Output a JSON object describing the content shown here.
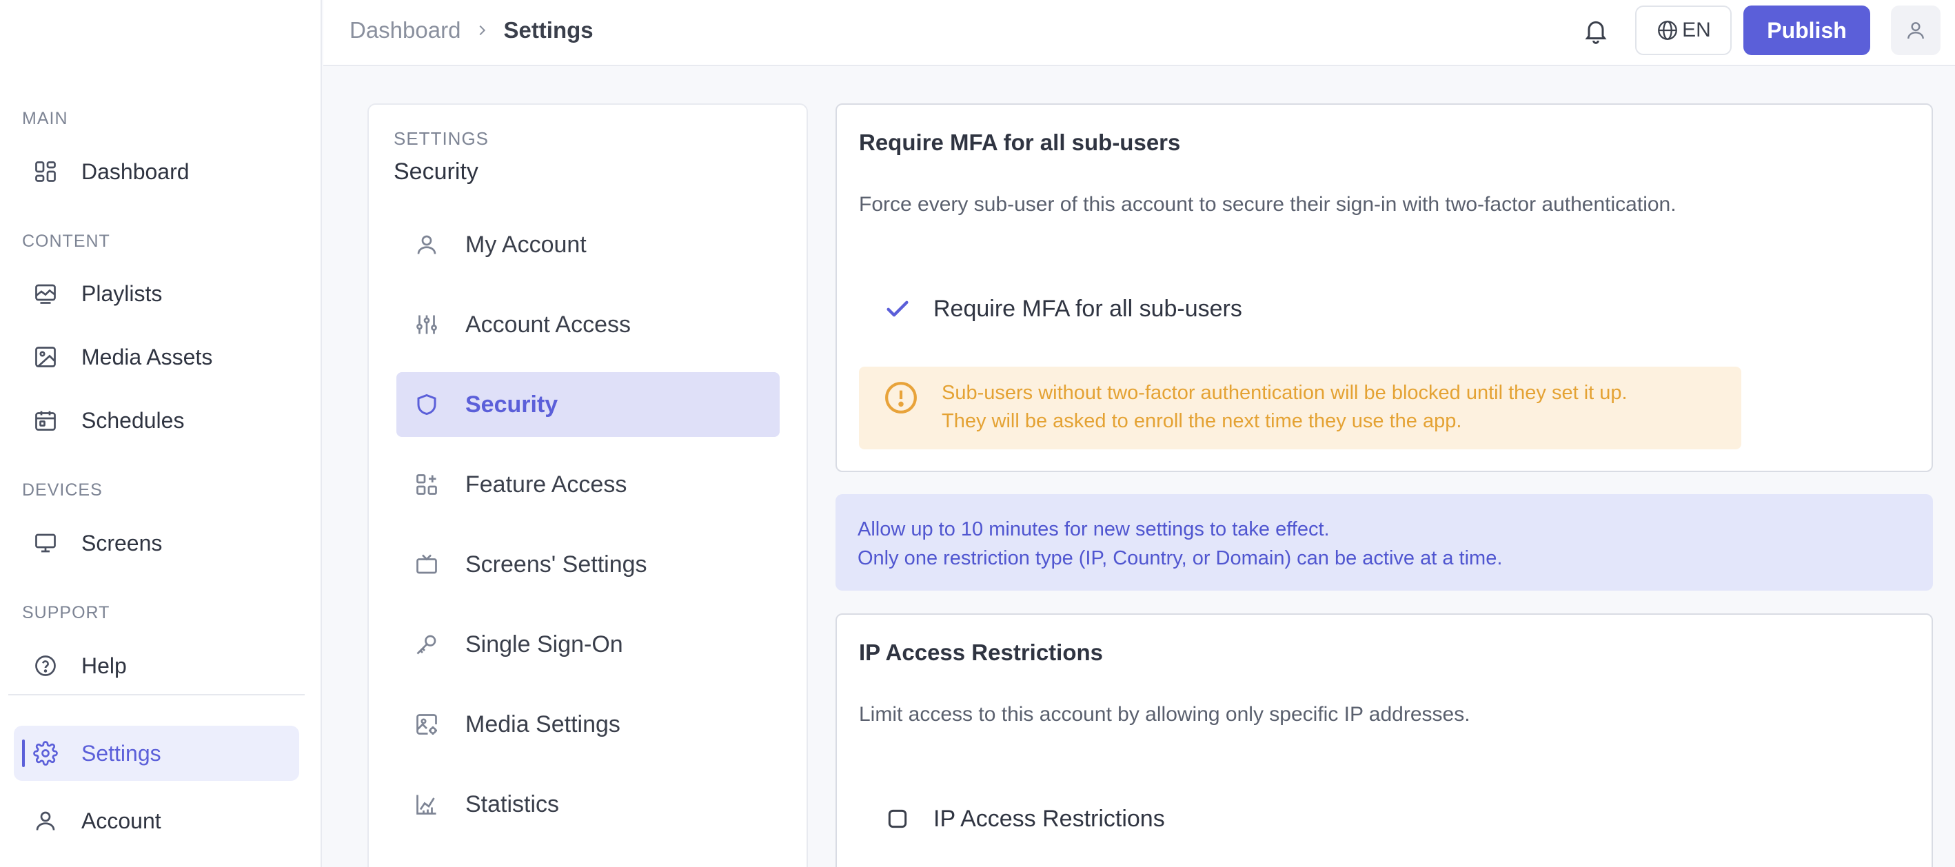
{
  "sidebar": {
    "groups": {
      "main": "MAIN",
      "content": "CONTENT",
      "devices": "DEVICES",
      "support": "SUPPORT"
    },
    "items": {
      "dashboard": "Dashboard",
      "playlists": "Playlists",
      "media_assets": "Media Assets",
      "schedules": "Schedules",
      "screens": "Screens",
      "help": "Help",
      "settings": "Settings",
      "account": "Account"
    },
    "active_item": "settings"
  },
  "topbar": {
    "breadcrumb": {
      "parent": "Dashboard",
      "current": "Settings"
    },
    "language": "EN",
    "publish_label": "Publish"
  },
  "settings_nav": {
    "kicker": "SETTINGS",
    "title": "Security",
    "items": [
      {
        "label": "My Account",
        "icon": "user-icon"
      },
      {
        "label": "Account Access",
        "icon": "sliders-icon"
      },
      {
        "label": "Security",
        "icon": "shield-icon"
      },
      {
        "label": "Feature Access",
        "icon": "grid-plus-icon"
      },
      {
        "label": "Screens' Settings",
        "icon": "tv-icon"
      },
      {
        "label": "Single Sign-On",
        "icon": "key-icon"
      },
      {
        "label": "Media Settings",
        "icon": "image-settings-icon"
      },
      {
        "label": "Statistics",
        "icon": "chart-icon"
      }
    ],
    "active_index": 2
  },
  "mfa_card": {
    "title": "Require MFA for all sub-users",
    "description": "Force every sub-user of this account to secure their sign-in with two-factor authentication.",
    "checkbox_label": "Require MFA for all sub-users",
    "checked": true,
    "warning_line1": "Sub-users without two-factor authentication will be blocked until they set it up.",
    "warning_line2": "They will be asked to enroll the next time they use the app."
  },
  "info_notice": {
    "line1": "Allow up to 10 minutes for new settings to take effect.",
    "line2": "Only one restriction type (IP, Country, or Domain) can be active at a time."
  },
  "ip_card": {
    "title": "IP Access Restrictions",
    "description": "Limit access to this account by allowing only specific IP addresses.",
    "checkbox_label": "IP Access Restrictions",
    "checked": false
  },
  "colors": {
    "accent": "#5b5fd9",
    "warning_text": "#e4a233",
    "warning_bg": "#fdf1df",
    "info_bg": "#e3e6fa"
  }
}
